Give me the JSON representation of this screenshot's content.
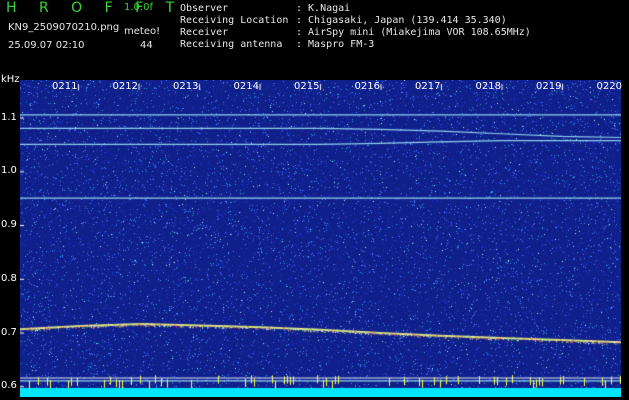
{
  "app": {
    "title": "H R O F F T",
    "version": "1.0.0f"
  },
  "file": {
    "name": "KN9_2509070210.png",
    "mode": "meteo!",
    "datetime": "25.09.07 02:10",
    "count": "44"
  },
  "meta": [
    {
      "label": "Observer",
      "value": ": K.Nagai"
    },
    {
      "label": "Receiving Location",
      "value": ": Chigasaki, Japan (139.414 35.340)"
    },
    {
      "label": "Receiver",
      "value": ": AirSpy mini (Miakejima VOR 108.65MHz)"
    },
    {
      "label": "Receiving antenna",
      "value": ": Maspro FM-3"
    }
  ],
  "axis": {
    "unit": "kHz",
    "y_ticks": [
      "1.1",
      "1.0",
      "0.9",
      "0.8",
      "0.7",
      "0.6"
    ]
  },
  "chart_data": {
    "type": "heatmap",
    "x": [
      "0211",
      "0212",
      "0213",
      "0214",
      "0215",
      "0216",
      "0217",
      "0218",
      "0219",
      "0220"
    ],
    "ylabel": "kHz",
    "ylim": [
      0.58,
      1.17
    ],
    "colors": {
      "background": "#10208a",
      "noise": "#4a7cff",
      "line": "#a8f0ff",
      "carrier": "#ffff80",
      "floor": "#00e5ff"
    },
    "series": [
      {
        "values": [
          1.105,
          1.105,
          1.105,
          1.105,
          1.105,
          1.105,
          1.105,
          1.105,
          1.105,
          1.105,
          1.105
        ]
      },
      {
        "values": [
          1.08,
          1.08,
          1.08,
          1.08,
          1.08,
          1.08,
          1.078,
          1.075,
          1.07,
          1.065,
          1.063
        ]
      },
      {
        "values": [
          1.05,
          1.05,
          1.05,
          1.05,
          1.05,
          1.05,
          1.052,
          1.055,
          1.057,
          1.057,
          1.057
        ]
      },
      {
        "values": [
          0.95,
          0.95,
          0.95,
          0.95,
          0.95,
          0.95,
          0.95,
          0.95,
          0.95,
          0.95,
          0.95
        ]
      },
      {
        "values": [
          0.706,
          0.712,
          0.716,
          0.713,
          0.71,
          0.705,
          0.699,
          0.694,
          0.69,
          0.686,
          0.682
        ]
      },
      {
        "values": [
          0.61,
          0.61,
          0.61,
          0.61,
          0.61,
          0.61,
          0.61,
          0.61,
          0.61,
          0.61,
          0.61
        ]
      }
    ]
  }
}
